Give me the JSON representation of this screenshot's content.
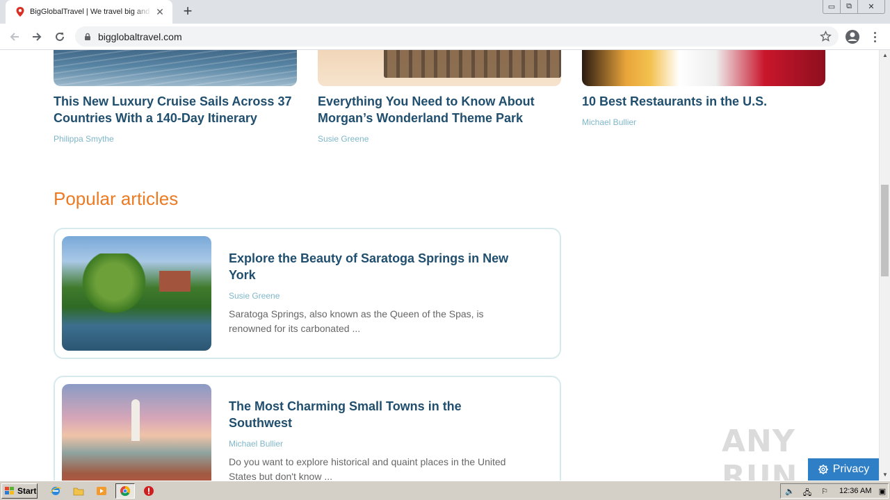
{
  "browser": {
    "tab_title": "BigGlobalTravel | We travel big and c",
    "tab_close": "✕",
    "new_tab": "+",
    "url": "bigglobaltravel.com",
    "window_controls": {
      "minimize": "▭",
      "maximize": "⧉",
      "close": "✕"
    }
  },
  "top_cards": [
    {
      "title": "This New Luxury Cruise Sails Across 37 Countries With a 140-Day Itinerary",
      "author": "Philippa Smythe",
      "image": "ocean-photo"
    },
    {
      "title": "Everything You Need to Know About Morgan’s Wonderland Theme Park",
      "author": "Susie Greene",
      "image": "train-photo"
    },
    {
      "title": "10 Best Restaurants in the U.S.",
      "author": "Michael Bullier",
      "image": "food-photo"
    }
  ],
  "popular": {
    "heading": "Popular articles",
    "items": [
      {
        "title": "Explore the Beauty of Saratoga Springs in New York",
        "author": "Susie Greene",
        "excerpt": "Saratoga Springs, also known as the Queen of the Spas, is renowned for its carbonated ..."
      },
      {
        "title": "The Most Charming Small Towns in the Southwest",
        "author": "Michael Bullier",
        "excerpt": "Do you want to explore historical and quaint places in the United States but don't know ..."
      }
    ]
  },
  "watermark": "ANY RUN",
  "privacy_button": "Privacy",
  "taskbar": {
    "start_label": "Start",
    "clock": "12:36 AM"
  },
  "colors": {
    "accent_orange": "#ec7a23",
    "title_blue": "#1f4e6e",
    "author_teal": "#7fb7c9",
    "privacy_blue": "#2f7fc7"
  }
}
